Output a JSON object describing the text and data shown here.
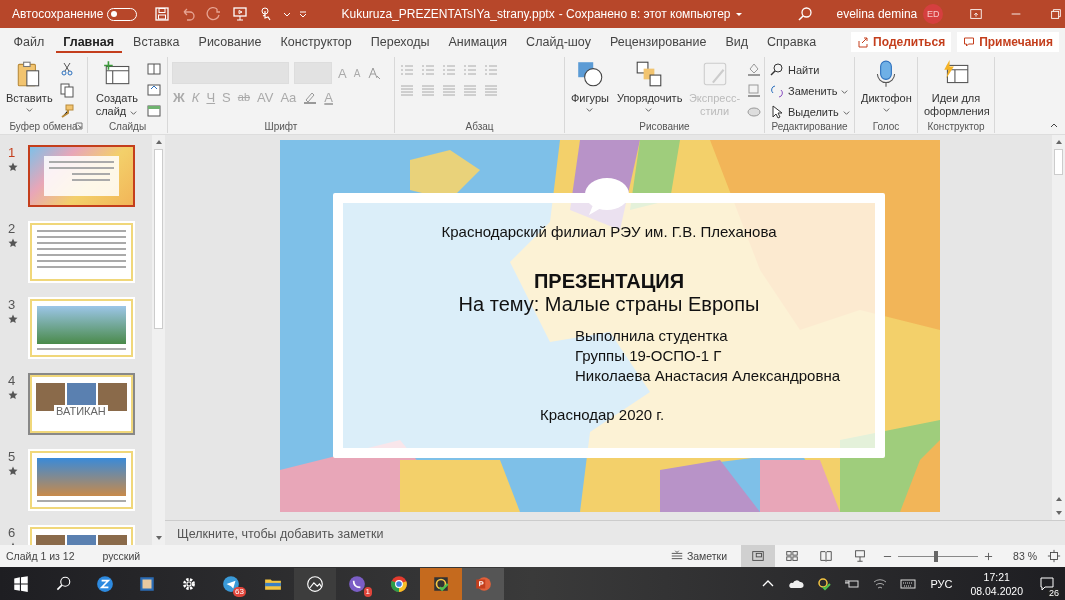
{
  "title_bar": {
    "autosave_label": "Автосохранение",
    "autosave_on": false,
    "file_name": "Kukuruza_PREZENTATsIYa_strany.pptx",
    "save_status": "- Сохранено в: этот компьютер",
    "user_name": "evelina demina",
    "user_initials": "ED"
  },
  "ribbon_tabs": [
    {
      "label": "Файл",
      "selected": false
    },
    {
      "label": "Главная",
      "selected": true
    },
    {
      "label": "Вставка",
      "selected": false
    },
    {
      "label": "Рисование",
      "selected": false
    },
    {
      "label": "Конструктор",
      "selected": false
    },
    {
      "label": "Переходы",
      "selected": false
    },
    {
      "label": "Анимация",
      "selected": false
    },
    {
      "label": "Слайд-шоу",
      "selected": false
    },
    {
      "label": "Рецензирование",
      "selected": false
    },
    {
      "label": "Вид",
      "selected": false
    },
    {
      "label": "Справка",
      "selected": false
    }
  ],
  "share_button": "Поделиться",
  "comments_button": "Примечания",
  "ribbon_groups": [
    {
      "label": "Буфер обмена"
    },
    {
      "label": "Слайды"
    },
    {
      "label": "Шрифт"
    },
    {
      "label": "Абзац"
    },
    {
      "label": "Рисование"
    },
    {
      "label": "Редактирование"
    },
    {
      "label": "Голос"
    },
    {
      "label": "Конструктор"
    }
  ],
  "paste_button": "Вставить",
  "new_slide_button": "Создать слайд",
  "font_disabled": true,
  "font_size_buttons": [
    "A",
    "A"
  ],
  "font_format_buttons": [
    "Ж",
    "К",
    "Ч",
    "S",
    "ab",
    "AV",
    "Aa"
  ],
  "font_color_button": "A",
  "drawing_buttons": [
    {
      "label": "Фигуры",
      "disabled": false
    },
    {
      "label": "Упорядочить",
      "disabled": false
    },
    {
      "label": "Экспресс-стили",
      "disabled": true
    }
  ],
  "editing_buttons": [
    "Найти",
    "Заменить",
    "Выделить"
  ],
  "dictate_button": "Диктофон",
  "design_ideas_button": "Идеи для оформления",
  "slides": [
    {
      "number": "1",
      "kind": "title",
      "selected": true,
      "hovered": false
    },
    {
      "number": "2",
      "kind": "text",
      "selected": false,
      "hovered": false
    },
    {
      "number": "3",
      "kind": "photo",
      "selected": false,
      "hovered": false
    },
    {
      "number": "4",
      "kind": "collage",
      "caption": "ВАТИКАН",
      "selected": false,
      "hovered": true
    },
    {
      "number": "5",
      "kind": "photo",
      "selected": false,
      "hovered": false
    },
    {
      "number": "6",
      "kind": "collage",
      "selected": false,
      "hovered": false
    }
  ],
  "slide": {
    "institution": "Краснодарский филиал РЭУ им. Г.В. Плеханова",
    "title": "ПРЕЗЕНТАЦИЯ",
    "subtitle": "На тему: Малые страны Европы",
    "author_lines": [
      "Выполнила студентка",
      "Группы 19-ОСПО-1 Г",
      "Николаева Анастасия Александровна"
    ],
    "place_date": "Краснодар 2020 г."
  },
  "notes_placeholder": "Щелкните, чтобы добавить заметки",
  "status_bar": {
    "slide_counter": "Слайд 1 из 12",
    "language": "русский",
    "notes_button": "Заметки",
    "views": [
      {
        "selected": true
      },
      {
        "selected": false
      },
      {
        "selected": false
      },
      {
        "selected": false
      }
    ],
    "zoom": {
      "level": 0.48,
      "reading": "83 %"
    }
  },
  "taskbar": {
    "badges": [
      "63",
      "1"
    ],
    "language": "РУС",
    "time": "17:21",
    "date": "08.04.2020",
    "notification_count": "26"
  }
}
